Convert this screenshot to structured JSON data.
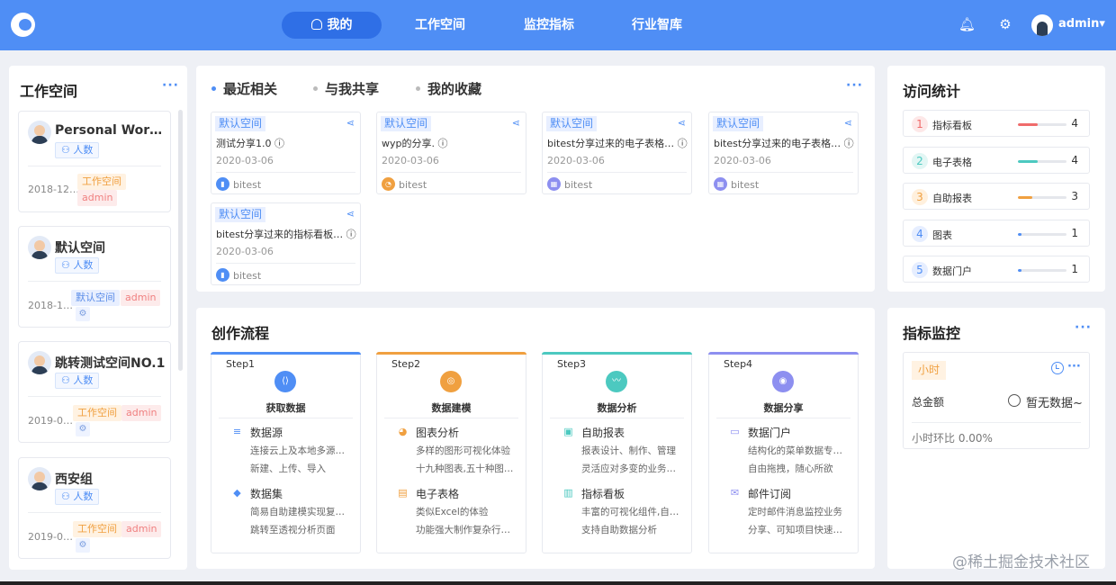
{
  "nav": {
    "items": [
      {
        "label": "我的"
      },
      {
        "label": "工作空间"
      },
      {
        "label": "监控指标"
      },
      {
        "label": "行业智库"
      }
    ],
    "user": "admin▾",
    "accent": "#4f8ef5"
  },
  "workspace": {
    "title": "工作空间",
    "more": "···",
    "cards": [
      {
        "name": "Personal Works…",
        "count": "人数",
        "date": "2018-12…",
        "tags": [
          "工作空间",
          "admin"
        ]
      },
      {
        "name": "默认空间",
        "count": "人数",
        "date": "2018-1…",
        "tags": [
          "默认空间",
          "admin"
        ]
      },
      {
        "name": "跳转测试空间NO.1",
        "count": "人数",
        "date": "2019-0…",
        "tags": [
          "工作空间",
          "admin"
        ]
      },
      {
        "name": "西安组",
        "count": "人数",
        "date": "2019-0…",
        "tags": [
          "工作空间",
          "admin"
        ]
      }
    ]
  },
  "recent": {
    "tabs": [
      "最近相关",
      "与我共享",
      "我的收藏"
    ],
    "more": "···",
    "cards": [
      {
        "tag": "默认空间",
        "title": "测试分享1.0 ⓘ",
        "date": "2020-03-06",
        "owner": "bitest"
      },
      {
        "tag": "默认空间",
        "title": "wyp的分享. ⓘ",
        "date": "2020-03-06",
        "owner": "bitest"
      },
      {
        "tag": "默认空间",
        "title": "bitest分享过来的电子表格… ⓘ",
        "date": "2020-03-06",
        "owner": "bitest"
      },
      {
        "tag": "默认空间",
        "title": "bitest分享过来的电子表格… ⓘ",
        "date": "2020-03-06",
        "owner": "bitest"
      },
      {
        "tag": "默认空间",
        "title": "bitest分享过来的指标看板… ⓘ",
        "date": "2020-03-06",
        "owner": "bitest"
      }
    ]
  },
  "stats": {
    "title": "访问统计",
    "rows": [
      {
        "rank": "1",
        "label": "指标看板",
        "value": "4",
        "fraction": 0.4,
        "color": "#f06b6b"
      },
      {
        "rank": "2",
        "label": "电子表格",
        "value": "4",
        "fraction": 0.4,
        "color": "#4cc9c0"
      },
      {
        "rank": "3",
        "label": "自助报表",
        "value": "3",
        "fraction": 0.3,
        "color": "#f0a040"
      },
      {
        "rank": "4",
        "label": "图表",
        "value": "1",
        "fraction": 0.08,
        "color": "#4f8ef5"
      },
      {
        "rank": "5",
        "label": "数据门户",
        "value": "1",
        "fraction": 0.08,
        "color": "#4f8ef5"
      }
    ]
  },
  "workflow": {
    "title": "创作流程",
    "steps": [
      {
        "step": "Step1",
        "title": "获取数据",
        "color": "#4f8ef5",
        "features": [
          {
            "title": "数据源",
            "desc": [
              "连接云上及本地多源…",
              "新建、上传、导入"
            ]
          },
          {
            "title": "数据集",
            "desc": [
              "简易自助建模实现复…",
              "跳转至透视分析页面"
            ]
          }
        ]
      },
      {
        "step": "Step2",
        "title": "数据建模",
        "color": "#f0a040",
        "features": [
          {
            "title": "图表分析",
            "desc": [
              "多样的图形可视化体验",
              "十九种图表,五十种图…"
            ]
          },
          {
            "title": "电子表格",
            "desc": [
              "类似Excel的体验",
              "功能强大制作复杂行…"
            ]
          }
        ]
      },
      {
        "step": "Step3",
        "title": "数据分析",
        "color": "#4cc9c0",
        "features": [
          {
            "title": "自助报表",
            "desc": [
              "报表设计、制作、管理",
              "灵活应对多变的业务…"
            ]
          },
          {
            "title": "指标看板",
            "desc": [
              "丰富的可视化组件,自…",
              "支持自助数据分析"
            ]
          }
        ]
      },
      {
        "step": "Step4",
        "title": "数据分享",
        "color": "#8d8ff0",
        "features": [
          {
            "title": "数据门户",
            "desc": [
              "结构化的菜单数据专…",
              "自由拖拽，随心所欲"
            ]
          },
          {
            "title": "邮件订阅",
            "desc": [
              "定时邮件消息监控业务",
              "分享、可知项目快速…"
            ]
          }
        ]
      }
    ]
  },
  "monitor": {
    "title": "指标监控",
    "more": "···",
    "tag": "小时",
    "label": "总金额",
    "nodata": "暂无数据~",
    "ratio": "小时环比  0.00%"
  },
  "watermark": "@稀土掘金技术社区"
}
